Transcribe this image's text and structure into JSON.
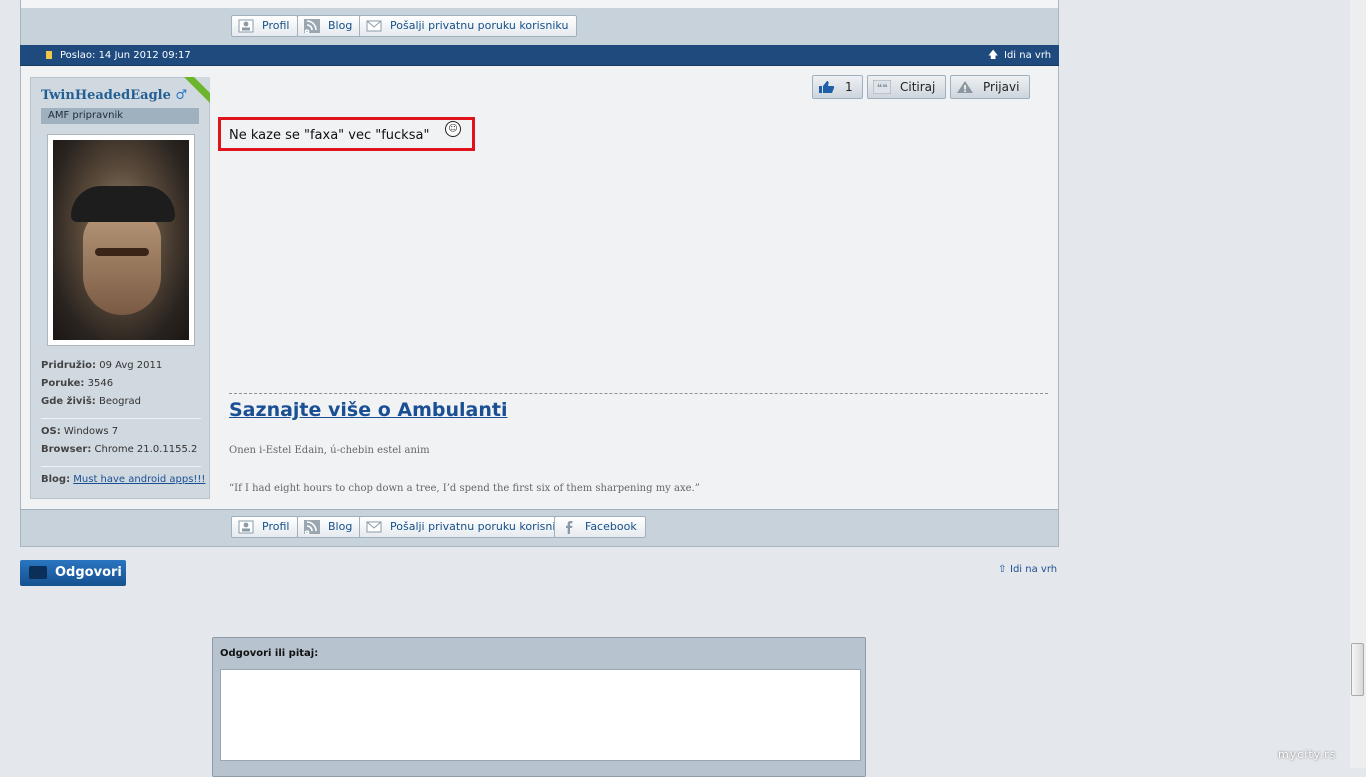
{
  "top_footer": {
    "buttons": [
      "Profil",
      "Blog",
      "Pošalji privatnu poruku korisniku"
    ]
  },
  "post_header": {
    "posted": "Poslao: 14 Jun 2012 09:17",
    "to_top": "Idi na vrh"
  },
  "user": {
    "name": "TwinHeadedEagle",
    "gender_symbol": "♂",
    "rank": "AMF pripravnik",
    "joined_label": "Pridružio:",
    "joined": "09 Avg 2011",
    "posts_label": "Poruke:",
    "posts": "3546",
    "location_label": "Gde živiš:",
    "location": "Beograd",
    "os_label": "OS:",
    "os": "Windows 7",
    "browser_label": "Browser:",
    "browser": "Chrome 21.0.1155.2",
    "blog_label": "Blog:",
    "blog": "Must have android apps!!!"
  },
  "actions": {
    "like_count": "1",
    "quote": "Citiraj",
    "report": "Prijavi"
  },
  "message": {
    "text": "Ne kaze se \"faxa\" vec \"fucksa\"",
    "highlight_color": "#e0121b"
  },
  "signature": {
    "title": "Saznajte više o Ambulanti",
    "line1": "Onen i-Estel Edain, ú-chebin estel anim",
    "line2": "“If I had eight hours to chop down a tree, I’d spend the first six of them sharpening my axe.”"
  },
  "bottom_footer": {
    "buttons": [
      "Profil",
      "Blog",
      "Pošalji privatnu poruku korisniku",
      "Facebook"
    ]
  },
  "reply": {
    "button": "Odgovori",
    "to_top": "Idi na vrh"
  },
  "quick_reply": {
    "label": "Odgovori ili pitaj:"
  },
  "watermark": "mycity.rs",
  "colors": {
    "header_blue": "#1e4a7e",
    "link_blue": "#1a4f93",
    "accent_green": "#6cb52f"
  }
}
